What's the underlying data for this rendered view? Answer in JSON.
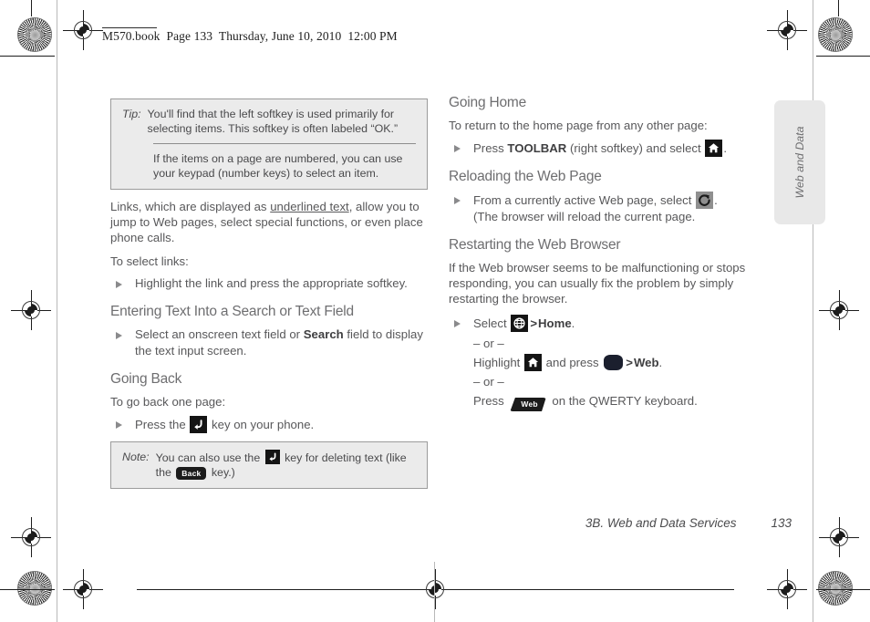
{
  "header": {
    "text": "M570.book  Page 133  Thursday, June 10, 2010  12:00 PM"
  },
  "side_tab": {
    "label": "Web and Data"
  },
  "footer": {
    "chapter": "3B. Web and Data Services",
    "page_number": "133"
  },
  "left_column": {
    "tip_box": {
      "label": "Tip:",
      "paragraph_1": "You'll find that the left softkey is used primarily for selecting items. This softkey is often labeled “OK.”",
      "paragraph_2": "If the items on a page are numbered, you can use your keypad (number keys) to select an item."
    },
    "links_paragraph_part1": "Links, which are displayed as ",
    "links_paragraph_underlined": "underlined text",
    "links_paragraph_part2": ", allow you to jump to Web pages, select special functions, or even place phone calls.",
    "to_select_links": "To select links:",
    "bullet_highlight_link": "Highlight the link and press the appropriate softkey.",
    "heading_entering_text": "Entering Text Into a Search or Text Field",
    "bullet_select_field_part1": "Select an onscreen text field or ",
    "bullet_select_field_bold": "Search",
    "bullet_select_field_part2": " field to display the text input screen.",
    "heading_going_back": "Going Back",
    "to_go_back": "To go back one page:",
    "bullet_press_part1": "Press the ",
    "bullet_press_part2": " key on your phone.",
    "note_box": {
      "label": "Note:",
      "text_part1": "You can also use the ",
      "text_part2": " key for deleting text (like the ",
      "back_key_label": "Back",
      "text_part3": " key.)"
    }
  },
  "right_column": {
    "heading_going_home": "Going Home",
    "going_home_lead": "To return to the home page from any other page:",
    "bullet_press_toolbar_part1": "Press ",
    "bullet_press_toolbar_bold": "TOOLBAR",
    "bullet_press_toolbar_part2": " (right softkey) and select ",
    "bullet_press_toolbar_part3": ".",
    "heading_reloading": "Reloading the Web Page",
    "bullet_reload_part1": "From a currently active Web page, select ",
    "bullet_reload_part2": ".",
    "bullet_reload_part3": "(The browser will reload the current page.",
    "heading_restarting": "Restarting the Web Browser",
    "restarting_paragraph": "If the Web browser seems to be malfunctioning or stops responding, you can usually fix the problem by simply restarting the browser.",
    "bullet_select_globe_part1": "Select ",
    "bullet_select_globe_gt": ">",
    "bullet_select_globe_bold": "Home",
    "bullet_select_globe_part2": ".",
    "or_separator": "– or –",
    "highlight_line_part1": "Highlight ",
    "highlight_line_part2": " and press ",
    "highlight_line_gt": ">",
    "highlight_line_bold": "Web",
    "highlight_line_part3": ".",
    "press_web_part1": "Press ",
    "press_web_key_label": "Web",
    "press_web_part2": " on the QWERTY keyboard."
  },
  "icons": {
    "back_key": "back-arrow-key-icon",
    "home": "home-icon",
    "reload": "reload-icon",
    "globe": "globe-icon",
    "ok_key": "ok-key-icon"
  },
  "colors": {
    "body_text": "#58585a",
    "heading_text": "#6e6e70",
    "callout_fill": "#ebebeb",
    "callout_border": "#9b9b9b",
    "icon_dark": "#141414",
    "icon_gray": "#8f8f8f",
    "side_tab_fill": "#e8e8e8"
  }
}
